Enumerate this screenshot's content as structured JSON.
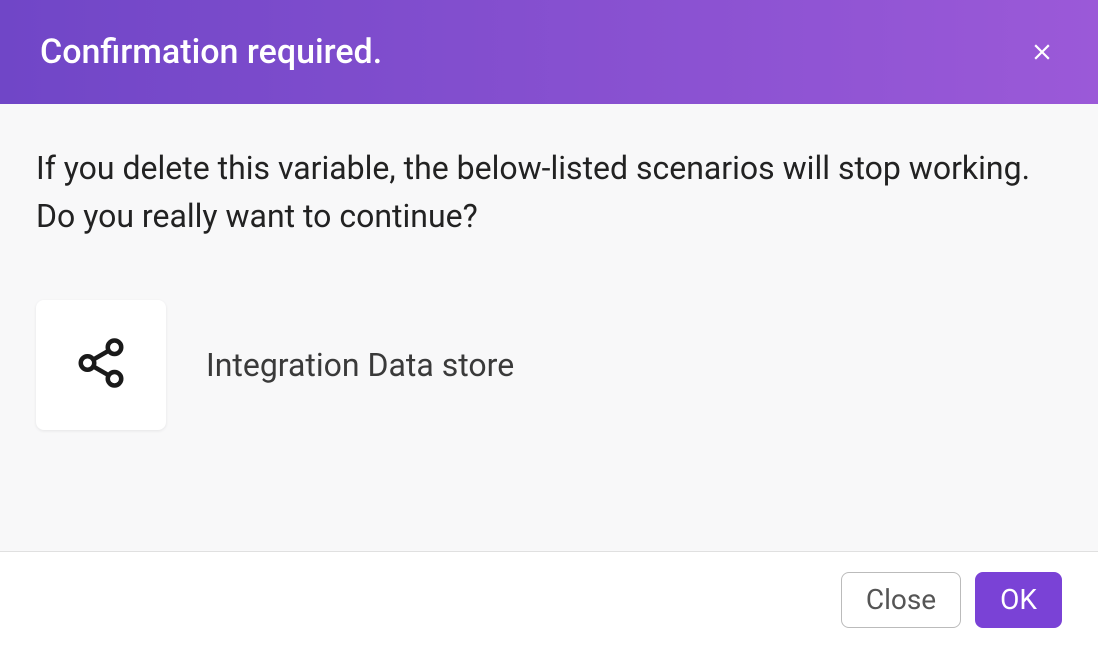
{
  "dialog": {
    "title": "Confirmation required.",
    "warning_text": "If you delete this variable, the below-listed scenarios will stop working. Do you really want to continue?",
    "scenarios": [
      {
        "name": "Integration Data store",
        "icon": "share-icon"
      }
    ],
    "footer": {
      "close_label": "Close",
      "ok_label": "OK"
    }
  }
}
